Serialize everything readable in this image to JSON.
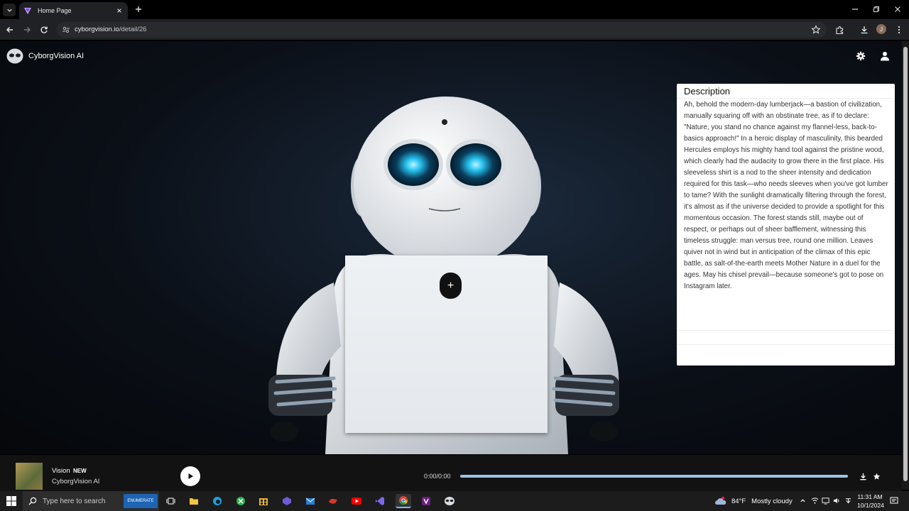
{
  "browser": {
    "tab_title": "Home Page",
    "url_host": "cyborgvision.io",
    "url_path": "/detail/26",
    "profile_initial": "J"
  },
  "app": {
    "brand": "CyborgVision AI"
  },
  "description": {
    "heading": "Description",
    "body": "Ah, behold the modern-day lumberjack—a bastion of civilization, manually squaring off with an obstinate tree, as if to declare: \"Nature, you stand no chance against my flannel-less, back-to-basics approach!\" In a heroic display of masculinity, this bearded Hercules employs his mighty hand tool against the pristine wood, which clearly had the audacity to grow there in the first place. His sleeveless shirt is a nod to the sheer intensity and dedication required for this task—who needs sleeves when you've got lumber to tame? With the sunlight dramatically filtering through the forest, it's almost as if the universe decided to provide a spotlight for this momentous occasion. The forest stands still, maybe out of respect, or perhaps out of sheer bafflement, witnessing this timeless struggle: man versus tree, round one million. Leaves quiver not in wind but in anticipation of the climax of this epic battle, as salt-of-the-earth meets Mother Nature in a duel for the ages. May his chisel prevail—because someone's got to pose on Instagram later."
  },
  "hero": {
    "add_label": "+"
  },
  "player": {
    "title": "Vision",
    "badge": "NEW",
    "artist": "CyborgVision AI",
    "time": "0:00/0:00",
    "progress": 0
  },
  "taskbar": {
    "search_placeholder": "Type here to search",
    "search_ad": "ENUMERATE",
    "weather_temp": "84°F",
    "weather_text": "Mostly cloudy",
    "time": "11:31 AM",
    "date": "10/1/2024"
  },
  "colors": {
    "accent": "#9ec3e6",
    "page_bg": "#0b1018",
    "chrome_bg": "#202124"
  }
}
